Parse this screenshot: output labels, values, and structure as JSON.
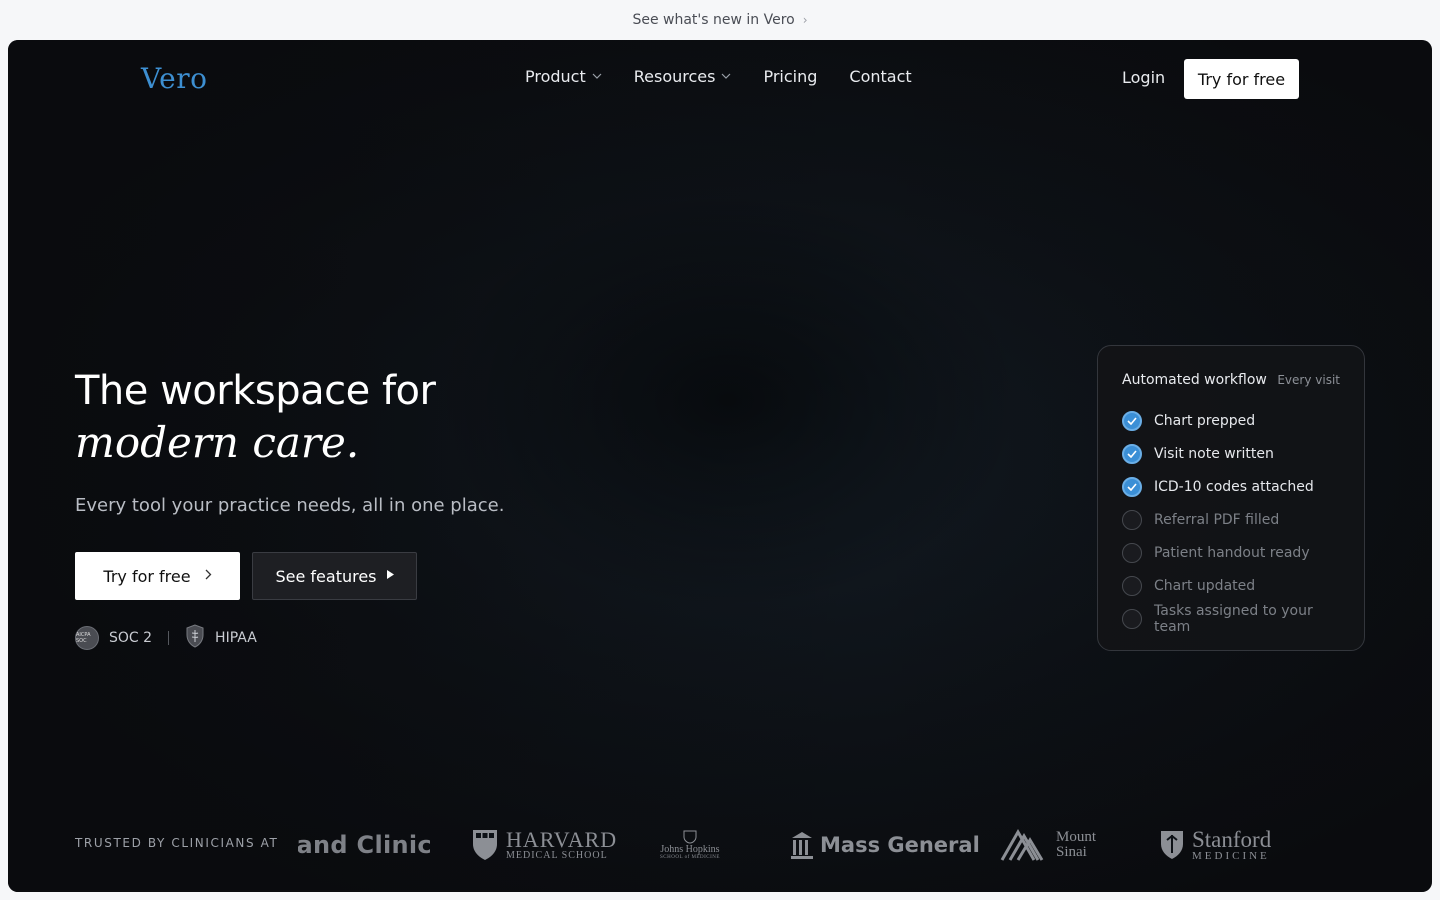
{
  "announcement": {
    "text": "See what's new in Vero",
    "chevron": "›"
  },
  "nav": {
    "logo": "Vero",
    "links": [
      {
        "label": "Product",
        "has_caret": true
      },
      {
        "label": "Resources",
        "has_caret": true
      },
      {
        "label": "Pricing",
        "has_caret": false
      },
      {
        "label": "Contact",
        "has_caret": false
      }
    ],
    "login": "Login",
    "cta": "Try for free"
  },
  "hero": {
    "title_line1": "The workspace for",
    "title_line2": "modern care.",
    "subtitle": "Every tool your practice needs, all in one place.",
    "primary_button": "Try for free",
    "secondary_button": "See features",
    "badges": [
      {
        "label": "SOC 2",
        "icon": "aicpa-soc-icon",
        "icon_text": "AICPA SOC"
      },
      {
        "label": "HIPAA",
        "icon": "shield-caduceus-icon"
      }
    ]
  },
  "workflow_card": {
    "title": "Automated workflow",
    "meta": "Every visit",
    "items": [
      {
        "label": "Chart prepped",
        "done": true
      },
      {
        "label": "Visit note written",
        "done": true
      },
      {
        "label": "ICD-10 codes attached",
        "done": true
      },
      {
        "label": "Referral PDF filled",
        "done": false
      },
      {
        "label": "Patient handout ready",
        "done": false
      },
      {
        "label": "Chart updated",
        "done": false
      },
      {
        "label": "Tasks assigned to your team",
        "done": false
      }
    ],
    "colors": {
      "done": "#3b8fd6",
      "pending": "#1a1b1f"
    }
  },
  "trusted": {
    "label": "TRUSTED BY CLINICIANS AT",
    "logos": {
      "clinic": "land Clinic",
      "harvard_big": "HARVARD",
      "harvard_small": "MEDICAL SCHOOL",
      "jh_big": "Johns Hopkins",
      "jh_small": "SCHOOL of MEDICINE",
      "mgh": "Mass General",
      "sinai_1": "Mount",
      "sinai_2": "Sinai",
      "stanford_big": "Stanford",
      "stanford_small": "MEDICINE"
    }
  },
  "colors": {
    "accent": "#3d8fd1",
    "hero_bg": "#0d1116",
    "page_bg": "#f6f7f9"
  }
}
